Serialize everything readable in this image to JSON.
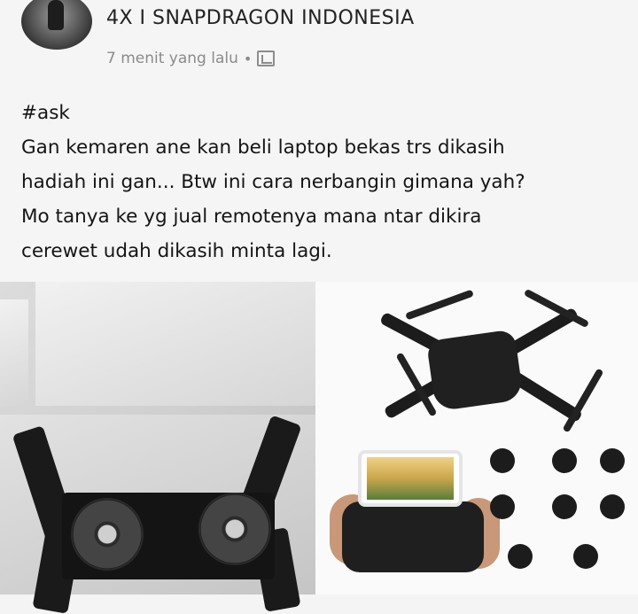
{
  "post": {
    "page_name": "4X I SNAPDRAGON INDONESIA",
    "timestamp": "7 menit yang lalu",
    "separator": "•",
    "body": "#ask\nGan kemaren ane kan beli laptop bekas trs dikasih\nhadiah ini gan... Btw ini cara nerbangin gimana yah?\nMo tanya ke yg jual remotenya mana ntar dikira\ncerewet udah dikasih minta lagi."
  },
  "icons": {
    "audience": "group-icon"
  }
}
